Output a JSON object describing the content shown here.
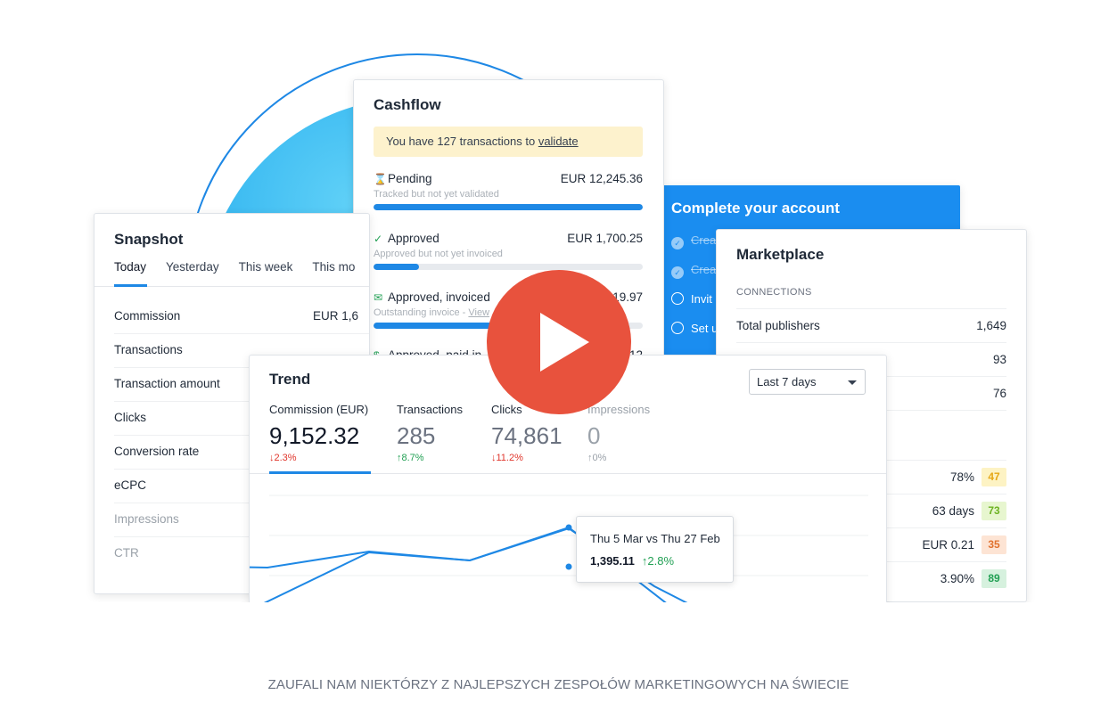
{
  "snapshot": {
    "title": "Snapshot",
    "tabs": [
      "Today",
      "Yesterday",
      "This week",
      "This mo"
    ],
    "rows": [
      {
        "label": "Commission",
        "value": "EUR 1,6"
      },
      {
        "label": "Transactions",
        "value": ""
      },
      {
        "label": "Transaction amount",
        "value": ""
      },
      {
        "label": "Clicks",
        "value": ""
      },
      {
        "label": "Conversion rate",
        "value": ""
      },
      {
        "label": "eCPC",
        "value": ""
      },
      {
        "label": "Impressions",
        "value": ""
      },
      {
        "label": "CTR",
        "value": ""
      }
    ]
  },
  "cashflow": {
    "title": "Cashflow",
    "notice_prefix": "You have 127 transactions to ",
    "notice_link": "validate",
    "items": [
      {
        "label": "Pending",
        "amount": "EUR 12,245.36",
        "sub": "Tracked but not yet validated",
        "progress": 1.0
      },
      {
        "label": "Approved",
        "amount": "EUR 1,700.25",
        "sub": "Approved but not yet invoiced",
        "progress": 0.17
      },
      {
        "label": "Approved, invoiced",
        "amount": "19.97",
        "sub": "Outstanding invoice - ",
        "sub_link": "View",
        "progress": 0.45
      },
      {
        "label": "Approved, paid in",
        "amount": "12",
        "sub": "",
        "progress": 0
      }
    ]
  },
  "complete": {
    "title": "Complete your account",
    "items": [
      {
        "label": "Crea",
        "done": true
      },
      {
        "label": "Crea",
        "done": true
      },
      {
        "label": "Invit",
        "done": false
      },
      {
        "label": "Set u",
        "done": false
      }
    ]
  },
  "marketplace": {
    "title": "Marketplace",
    "section": "CONNECTIONS",
    "rows": [
      {
        "label": "Total publishers",
        "value": "1,649"
      },
      {
        "label": "",
        "value": "93"
      },
      {
        "label": "",
        "value": "76"
      }
    ],
    "scores": [
      {
        "value": "78%",
        "score": "47",
        "bg": "#fdf3c4",
        "fg": "#e6a817"
      },
      {
        "value": "63 days",
        "score": "73",
        "bg": "#e7f6cf",
        "fg": "#6db322"
      },
      {
        "value": "EUR 0.21",
        "score": "35",
        "bg": "#fde4d4",
        "fg": "#e0722f"
      },
      {
        "value": "3.90%",
        "score": "89",
        "bg": "#d6f1de",
        "fg": "#22a054"
      }
    ]
  },
  "trend": {
    "title": "Trend",
    "range": "Last 7 days",
    "metrics": [
      {
        "label": "Commission (EUR)",
        "value": "9,152.32",
        "change": "2.3%",
        "dir": "down"
      },
      {
        "label": "Transactions",
        "value": "285",
        "change": "8.7%",
        "dir": "up"
      },
      {
        "label": "Clicks",
        "value": "74,861",
        "change": "11.2%",
        "dir": "down"
      },
      {
        "label": "Impressions",
        "value": "0",
        "change": "0%",
        "dir": "flat"
      }
    ],
    "tooltip": {
      "title": "Thu 5 Mar vs Thu 27 Feb",
      "value": "1,395.11",
      "change": "2.8%"
    }
  },
  "footer": "ZAUFALI NAM NIEKTÓRZY Z NAJLEPSZYCH ZESPOŁÓW MARKETINGOWYCH NA ŚWIECIE",
  "colors": {
    "accent": "#1e88e5",
    "play": "#e8523d",
    "down": "#e0352b",
    "up": "#22a054"
  }
}
